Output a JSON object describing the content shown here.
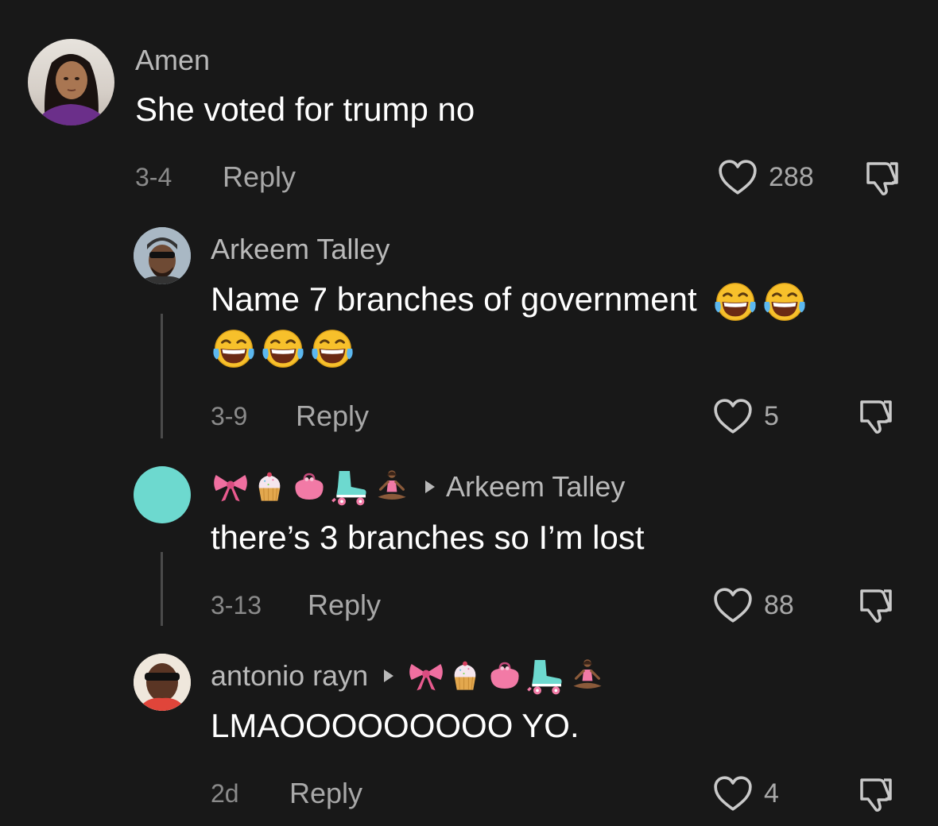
{
  "comments": [
    {
      "username": "Amen",
      "text": "She voted for trump no",
      "date": "3-4",
      "reply_label": "Reply",
      "likes": "288"
    },
    {
      "username": "Arkeem Talley",
      "text_line1": "Name 7 branches of government",
      "date": "3-9",
      "reply_label": "Reply",
      "likes": "5"
    },
    {
      "reply_to": "Arkeem Talley",
      "text": "there’s 3 branches so I’m lost",
      "date": "3-13",
      "reply_label": "Reply",
      "likes": "88"
    },
    {
      "username": "antonio rayn",
      "text": "LMAOOOOOOOOO YO.",
      "date": "2d",
      "reply_label": "Reply",
      "likes": "4"
    }
  ],
  "icons": {
    "like": "heart-outline-icon",
    "dislike": "thumbs-down-outline-icon",
    "reply_arrow": "triangle-right-icon",
    "emoji_laugh": "tears-of-joy-emoji",
    "emoji_bow": "ribbon-emoji",
    "emoji_cupcake": "cupcake-emoji",
    "emoji_purse": "purse-emoji",
    "emoji_skate": "roller-skate-emoji",
    "emoji_yoga": "person-in-lotus-position-emoji"
  },
  "colors": {
    "background": "#181818",
    "username": "#b9b9b9",
    "text": "#ffffff",
    "meta": "#8a8a8a",
    "avatar_teal": "#6dd9cf"
  }
}
